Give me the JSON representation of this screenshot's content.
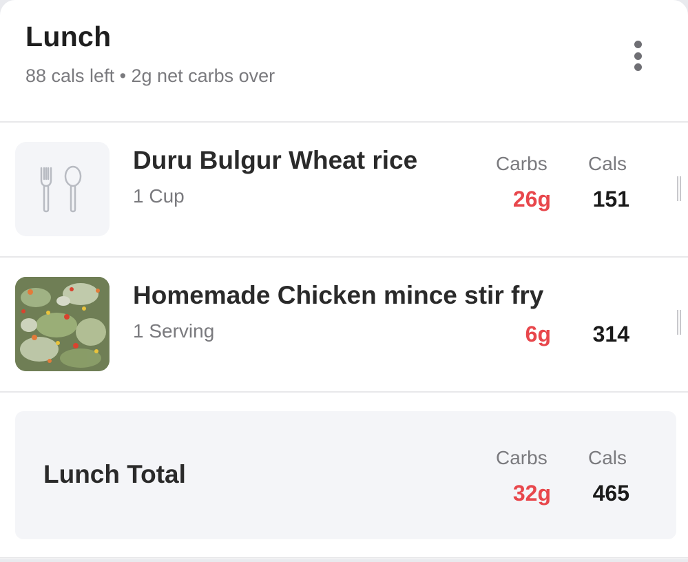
{
  "meal": {
    "title": "Lunch",
    "subtitle": "88 cals left • 2g net carbs over"
  },
  "menu_icon": "more-vertical-icon",
  "columns": {
    "carbs_label": "Carbs",
    "cals_label": "Cals"
  },
  "items": [
    {
      "name": "Duru Bulgur Wheat rice",
      "portion": "1 Cup",
      "carbs": "26g",
      "cals": "151",
      "thumbnail": "fork-spoon-icon"
    },
    {
      "name": "Homemade Chicken mince stir fry",
      "portion": "1 Serving",
      "carbs": "6g",
      "cals": "314",
      "thumbnail": "food-photo"
    }
  ],
  "total": {
    "label": "Lunch Total",
    "carbs": "32g",
    "cals": "465"
  },
  "colors": {
    "carbs_accent": "#e8474c",
    "panel_background": "#f4f5f8"
  }
}
